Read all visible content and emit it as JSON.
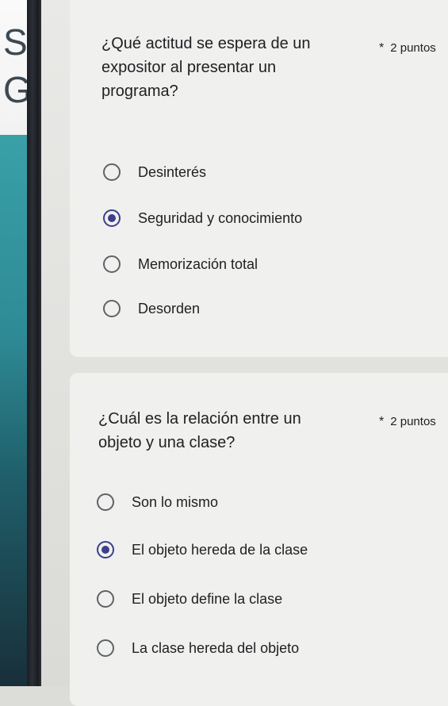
{
  "questions": [
    {
      "text_lines": [
        "¿Qué actitud se espera de un",
        "expositor al presentar un",
        "programa?"
      ],
      "required_mark": "*",
      "points": "2 puntos",
      "options": [
        {
          "label": "Desinterés",
          "selected": false
        },
        {
          "label": "Seguridad y conocimiento",
          "selected": true
        },
        {
          "label": "Memorización total",
          "selected": false
        },
        {
          "label": "Desorden",
          "selected": false
        }
      ]
    },
    {
      "text_lines": [
        "¿Cuál es la relación entre un",
        "objeto y una clase?"
      ],
      "required_mark": "*",
      "points": "2 puntos",
      "options": [
        {
          "label": "Son lo mismo",
          "selected": false
        },
        {
          "label": "El objeto hereda de la clase",
          "selected": true
        },
        {
          "label": "El objeto define la clase",
          "selected": false
        },
        {
          "label": "La clase hereda del objeto",
          "selected": false
        }
      ]
    }
  ],
  "bezel_letters": [
    "S",
    "G"
  ],
  "colors": {
    "accent": "#3b3f8c",
    "text": "#202124",
    "radio_border": "#5f6368"
  }
}
